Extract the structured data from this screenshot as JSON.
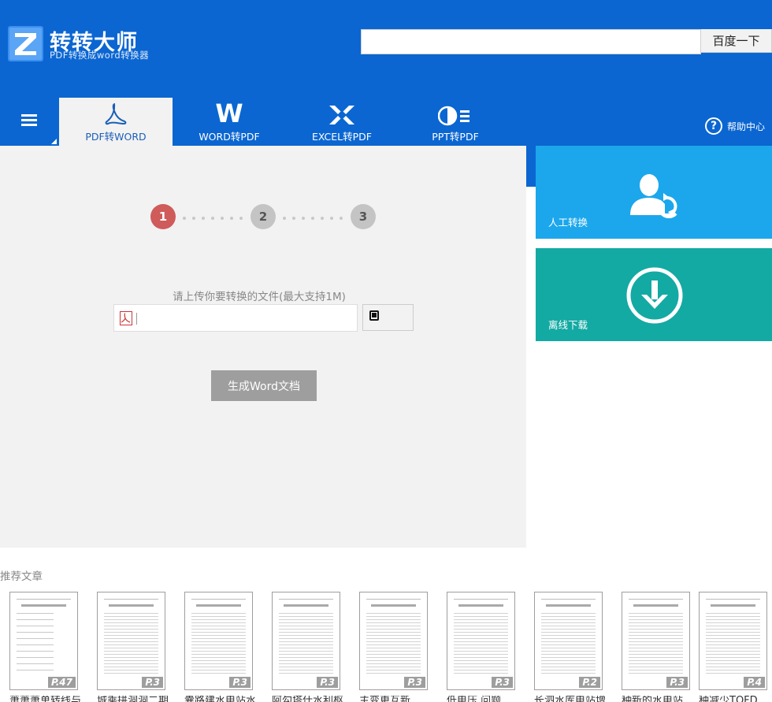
{
  "brand": {
    "title": "转转大师",
    "subtitle": "PDF转换成word转换器",
    "logo_letter": "Z"
  },
  "search": {
    "value": "",
    "button_label": "百度一下"
  },
  "nav": {
    "tabs": [
      {
        "id": "pdf2word",
        "label": "PDF转WORD",
        "icon": "pdf-icon",
        "active": true
      },
      {
        "id": "word2pdf",
        "label": "WORD转PDF",
        "icon": "word-icon",
        "glyph": "W",
        "active": false
      },
      {
        "id": "excel2pdf",
        "label": "EXCEL转PDF",
        "icon": "excel-icon",
        "active": false
      },
      {
        "id": "ppt2pdf",
        "label": "PPT转PDF",
        "icon": "ppt-icon",
        "active": false
      }
    ],
    "help_label": "帮助中心",
    "help_glyph": "?"
  },
  "steps": [
    "1",
    "2",
    "3"
  ],
  "upload": {
    "tip": "请上传你要转换的文件(最大支持1M)",
    "file_value": ""
  },
  "generate_label": "生成Word文档",
  "tiles": {
    "manual_label": "人工转换",
    "offline_label": "离线下载"
  },
  "recommend": {
    "title": "推荐文章",
    "docs": [
      {
        "pages": "P.47",
        "title": "萧萧萧单转线与"
      },
      {
        "pages": "P.3",
        "title": "城乘拼洞洞二期"
      },
      {
        "pages": "P.3",
        "title": "囊路建水电站水"
      },
      {
        "pages": "P.3",
        "title": "阿勾塔什水利枢"
      },
      {
        "pages": "P.3",
        "title": "主变更互新"
      },
      {
        "pages": "P.3",
        "title": "低电压 问题"
      },
      {
        "pages": "P.2",
        "title": "长泗水库电站增"
      },
      {
        "pages": "P.3",
        "title": "种新的水电站"
      },
      {
        "pages": "P.4",
        "title": "种减少TOFD"
      }
    ]
  },
  "colors": {
    "header_blue": "#0b66d1",
    "tile_manual": "#1ca7ec",
    "tile_offline": "#13aaa3",
    "step_active": "#cf5b5b"
  }
}
